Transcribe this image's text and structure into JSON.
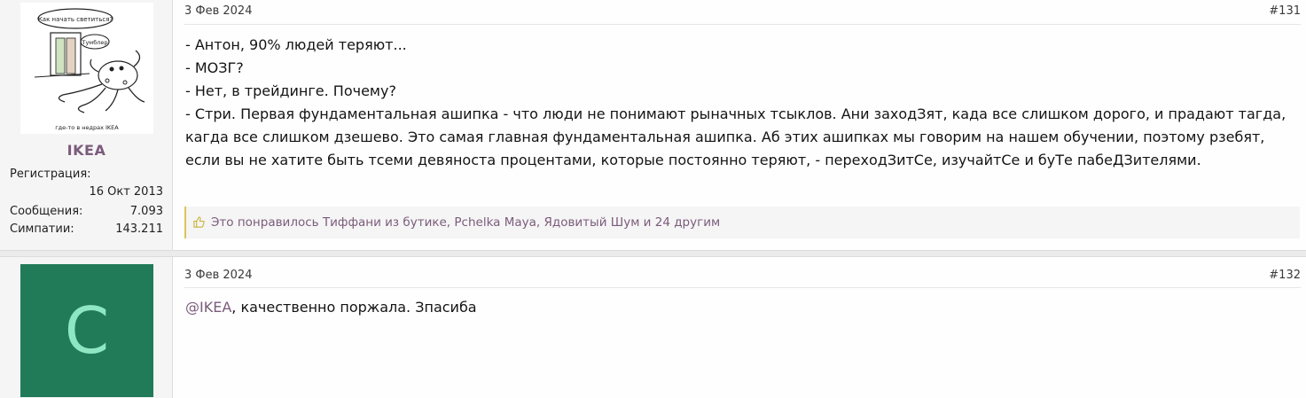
{
  "post1": {
    "username": "IKEA",
    "avatar_caption": "где-то в недрах IKEA",
    "avatar_bubble1": "Как начать светиться?",
    "avatar_bubble2": "Тумблер",
    "stats": {
      "reg_label": "Регистрация:",
      "reg_date": "16 Окт 2013",
      "msgs_label": "Сообщения:",
      "msgs_value": "7.093",
      "likes_label": "Симпатии:",
      "likes_value": "143.211"
    },
    "date": "3 Фев 2024",
    "number": "#131",
    "lines": [
      "- Антон, 90% людей теряют...",
      "- МОЗГ?",
      "- Нет, в трейдинге. Почему?",
      "- Стри. Первая фундаментальная ашипка - что люди не понимают рыначных тсыклов. Ани заходЗят, када все слишком дорого, и прадают тагда,",
      "кагда все слишком дзешево. Это самая главная фундаментальная ашипка. Аб этих ашипках мы говорим на нашем обучении, поэтому рзебят,",
      "если вы не хатите быть тсеми девяноста процентами, которые постоянно теряют, - переходЗитСе, изучайтСе и буТе пабеДЗителями."
    ],
    "likes_text": "Это понравилось Тиффани из бутике, Pchelka Maya, Ядовитый Шум и 24 другим",
    "accent_color": "#d9c55a"
  },
  "post2": {
    "avatar_letter": "C",
    "avatar_color": "#217b59",
    "date": "3 Фев 2024",
    "number": "#132",
    "mention": "@IKEA",
    "text": ", качественно поржала. Зпасиба"
  }
}
